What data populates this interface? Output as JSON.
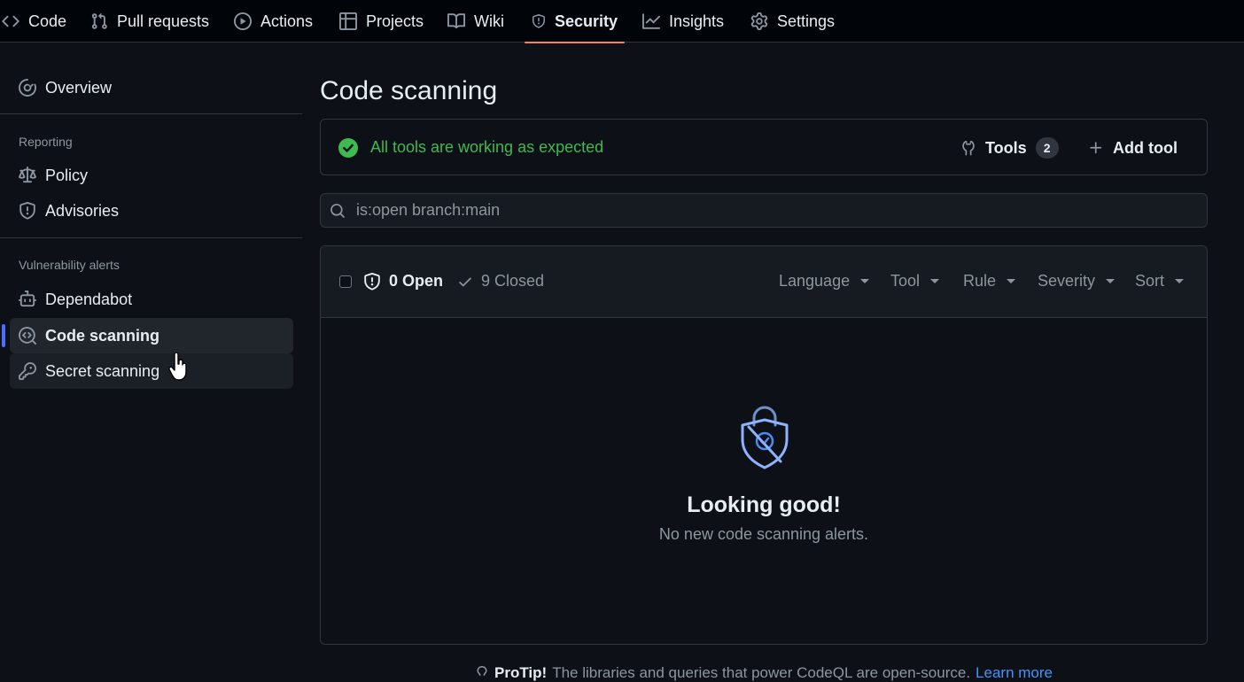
{
  "topnav": {
    "tabs": [
      {
        "label": "Code",
        "icon": "code-icon"
      },
      {
        "label": "Pull requests",
        "icon": "git-pull-request-icon"
      },
      {
        "label": "Actions",
        "icon": "play-icon"
      },
      {
        "label": "Projects",
        "icon": "table-icon"
      },
      {
        "label": "Wiki",
        "icon": "book-icon"
      },
      {
        "label": "Security",
        "icon": "shield-icon",
        "selected": true
      },
      {
        "label": "Insights",
        "icon": "graph-icon"
      },
      {
        "label": "Settings",
        "icon": "gear-icon"
      }
    ]
  },
  "sidebar": {
    "overview": "Overview",
    "reporting_heading": "Reporting",
    "policy": "Policy",
    "advisories": "Advisories",
    "vuln_heading": "Vulnerability alerts",
    "dependabot": "Dependabot",
    "code_scanning": "Code scanning",
    "secret_scanning": "Secret scanning"
  },
  "main": {
    "title": "Code scanning",
    "status": "All tools are working as expected",
    "tools_label": "Tools",
    "tools_count": "2",
    "add_tool_label": "Add tool",
    "search_value": "is:open branch:main",
    "open_label": "0 Open",
    "closed_label": "9 Closed",
    "filters": [
      "Language",
      "Tool",
      "Rule",
      "Severity",
      "Sort"
    ],
    "empty_title": "Looking good!",
    "empty_subtitle": "No new code scanning alerts.",
    "protip_bold": "ProTip!",
    "protip_text": "The libraries and queries that power CodeQL are open-source.",
    "protip_link": "Learn more"
  },
  "colors": {
    "background": "#0d1117",
    "success": "#3fb950",
    "selected_underline": "#f78166",
    "active_indicator": "#4c6fff",
    "link": "#4493f8"
  }
}
